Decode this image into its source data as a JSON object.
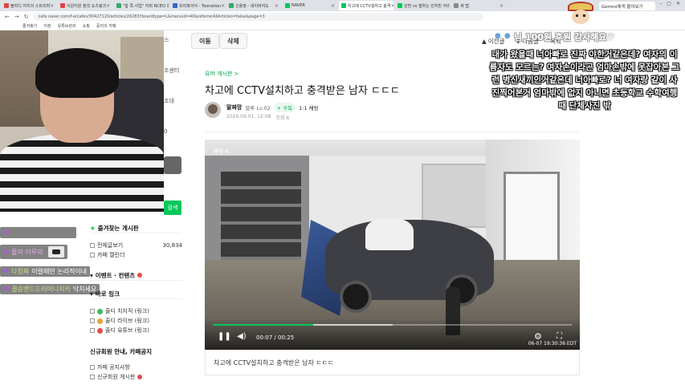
{
  "browser": {
    "tabs": [
      {
        "label": "블리디 지지의 스트리머",
        "fav": "#d44"
      },
      {
        "label": "이원지원 창섯 쇼츠링크",
        "fav": "#d44"
      },
      {
        "label": "\"합 쪽 사업\" 어퍼 NCEO 흐",
        "fav": "#3a6"
      },
      {
        "label": "유리파이어 - Toonation",
        "fav": "#36c"
      },
      {
        "label": "신용정 - 네이버지도",
        "fav": "#3a6"
      },
      {
        "label": "NAVER",
        "fav": "#03c75a"
      },
      {
        "label": "차고에 CCTV설하고 충격",
        "fav": "#03c75a"
      },
      {
        "label": "감방 vs 벌하는 민지반 자리",
        "fav": "#03c75a"
      },
      {
        "label": "새 탭",
        "fav": "#888"
      }
    ],
    "gemini_tab": "Gemini에게 물어보기",
    "url": "cafe.naver.com/f-e/cafes/30427120/articles/26283?boardtype=L&menuid=40&referrerAllArticles=false&page=3",
    "bookmarks": [
      "즐겨찾기",
      "지창",
      "유튜브관리",
      "쇼핑",
      "중지의 카페"
    ]
  },
  "sidebar": {
    "side_bits": [
      "스",
      "조센터",
      "조대",
      "0",
      ""
    ],
    "write_label": "검색",
    "favorites_head": "즐겨찾는 게시판",
    "all_posts_label": "전체글보기",
    "all_posts_count": "30,834",
    "cafe_tag_label": "카페 캘린더",
    "events_head": "이벤트 · 컨텐츠",
    "link_head": "바로 링크",
    "links": [
      {
        "label": "줄디 치지직 (링크)",
        "color": "#3bbd5c"
      },
      {
        "label": "줄디 라이브 (링크)",
        "color": "#e9a23b"
      },
      {
        "label": "줄디 유튜브 (링크)",
        "color": "#e54b4b"
      }
    ],
    "notice_head": "신규회원 안내, 카페공지",
    "notices": [
      "카페 공지사항",
      "신규회원 게시판"
    ]
  },
  "chat": [
    {
      "nick": "",
      "text": "",
      "emote": true
    },
    {
      "nick": "물의 이무의",
      "text": "",
      "emote": true
    },
    {
      "nick": "다칭짜",
      "text": "이럴때만 논리적이네"
    },
    {
      "nick": "결승밴드드러머니지카",
      "text": "닥치세요"
    }
  ],
  "toolbar": {
    "move_label": "이동",
    "delete_label": "삭제",
    "prev_label": "이전글",
    "next_label": "다음글",
    "list_label": "목록"
  },
  "article": {
    "board": "유머 게시판 >",
    "title": "차고에 CCTV설치하고 충격받은 남자 ㄷㄷㄷ",
    "author": "말짜망",
    "author_level": "블루 Lv.02",
    "subscribe": "구독",
    "chat": "1:1 채팅",
    "date": "2026.09.01. 12:08",
    "views": "조회 6",
    "caption": "차고에 CCTV설치하고 충격받은 남자 ㄷㄷㄷ"
  },
  "video": {
    "replay": "재생 6",
    "current": "00:07",
    "total": "00:25",
    "progress": 0.28,
    "buffered": 0.5,
    "timestamp": "06-07 19:30:36 EDT"
  },
  "overlay": {
    "top_line": "님 100원 후원 감사해요♡",
    "message": "내가 왔을때 너아빠로 진짜 야한거같은데? 여자의 이름자도 모르는? 여자손이라곤 엄마손밖에 못잡아본 그런 병신새끼인거같은데 너아빠로? 너 여자랑 같이 사진찍어본거 엄마밖에 없지 아니면 초등학교 수학여행때 단체사진 밖"
  },
  "colors": {
    "naver_green": "#03c75a",
    "accent_green": "#03a94a"
  }
}
